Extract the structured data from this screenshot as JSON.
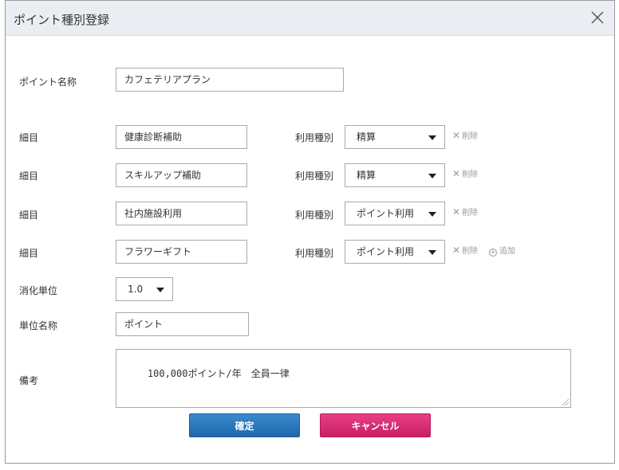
{
  "dialog": {
    "title": "ポイント種別登録"
  },
  "form": {
    "point_name_label": "ポイント名称",
    "point_name_value": "カフェテリアプラン",
    "item_label": "細目",
    "usage_type_label": "利用種別",
    "delete_label": "削除",
    "add_label": "追加",
    "items": [
      {
        "name": "健康診断補助",
        "usage_type": "精算"
      },
      {
        "name": "スキルアップ補助",
        "usage_type": "精算"
      },
      {
        "name": "社内施設利用",
        "usage_type": "ポイント利用"
      },
      {
        "name": "フラワーギフト",
        "usage_type": "ポイント利用"
      }
    ],
    "consumption_unit_label": "消化単位",
    "consumption_unit_value": "1.0",
    "unit_name_label": "単位名称",
    "unit_name_value": "ポイント",
    "remarks_label": "備考",
    "remarks_value": "100,000ポイント/年　全員一律"
  },
  "buttons": {
    "confirm_label": "確定",
    "cancel_label": "キャンセル"
  },
  "colors": {
    "header_bg": "#eaeef2",
    "confirm": "#2a78bf",
    "cancel": "#d92a73"
  }
}
